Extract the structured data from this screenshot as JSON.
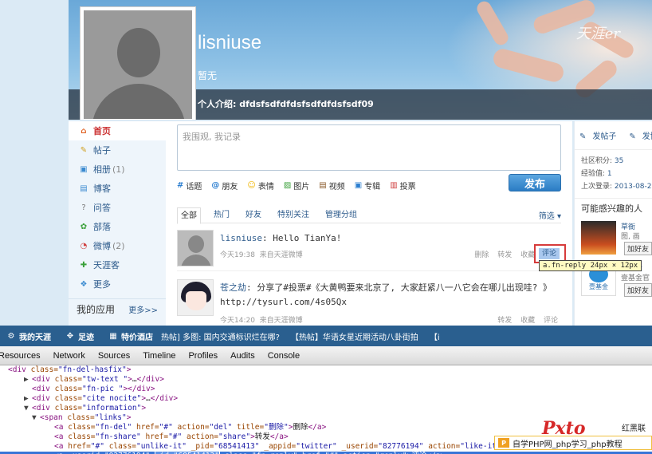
{
  "profile": {
    "name": "lisniuse",
    "status": "暂无",
    "intro": "个人介绍: dfdsfsdfdfdsfsdfdfdsfsdf09",
    "brand": "天涯er"
  },
  "nav": {
    "items": [
      {
        "label": "首页",
        "count": "",
        "icon": "home-icon",
        "active": true
      },
      {
        "label": "帖子",
        "count": "",
        "icon": "post-icon"
      },
      {
        "label": "相册",
        "count": "(1)",
        "icon": "album-icon"
      },
      {
        "label": "博客",
        "count": "",
        "icon": "blog-icon"
      },
      {
        "label": "问答",
        "count": "",
        "icon": "qa-icon"
      },
      {
        "label": "部落",
        "count": "",
        "icon": "tribe-icon"
      },
      {
        "label": "微博",
        "count": "(2)",
        "icon": "weibo-icon"
      },
      {
        "label": "天涯客",
        "count": "",
        "icon": "tianyake-icon"
      },
      {
        "label": "更多",
        "count": "",
        "icon": "more-icon"
      }
    ],
    "apps_label": "我的应用",
    "apps_more": "更多>>"
  },
  "composer": {
    "placeholder": "我围观, 我记录",
    "tools": [
      {
        "label": "话题",
        "icon": "topic-icon",
        "color": "#2d7fd0"
      },
      {
        "label": "朋友",
        "icon": "at-icon",
        "color": "#2d7fd0"
      },
      {
        "label": "表情",
        "icon": "emoji-icon",
        "color": "#f0b400"
      },
      {
        "label": "图片",
        "icon": "picture-icon",
        "color": "#3aa03a"
      },
      {
        "label": "视频",
        "icon": "video-icon",
        "color": "#8a5a2a"
      },
      {
        "label": "专辑",
        "icon": "album-icon",
        "color": "#2d7fd0"
      },
      {
        "label": "投票",
        "icon": "vote-icon",
        "color": "#d04040"
      }
    ],
    "publish_label": "发布"
  },
  "filters": {
    "tabs": [
      "全部",
      "热门",
      "好友",
      "特别关注",
      "管理分组"
    ],
    "sort_label": "筛选"
  },
  "posts": [
    {
      "user": "lisniuse",
      "text": ": Hello TianYa!",
      "time": "今天19:38",
      "source": "来自天涯微博",
      "actions": [
        "删除",
        "转发",
        "收藏",
        "评论"
      ]
    },
    {
      "user": "苍之劫",
      "text": ": 分享了#投票#《大黄鸭要来北京了, 大家赶紧八一八它会在哪儿出现哇? 》http://tysurl.com/4s05Qx",
      "time": "今天14:20",
      "source": "来自天涯微博",
      "actions": [
        "转发",
        "收藏",
        "评论"
      ]
    }
  ],
  "inspector": {
    "tooltip": "a.fn-reply 24px × 12px",
    "reply_label": "评论"
  },
  "right": {
    "links": [
      "发帖子",
      "发博文"
    ],
    "stats": [
      {
        "label": "社区积分:",
        "value": "35"
      },
      {
        "label": "经验值:",
        "value": "1"
      },
      {
        "label": "上次登录:",
        "value": "2013-08-2"
      }
    ],
    "rec_title": "可能感兴趣的人",
    "recs": [
      {
        "name": "草衙",
        "desc": "图, 画",
        "add": "加好友"
      },
      {
        "name": "壹基金",
        "desc": "壹基金官",
        "add": "加好友"
      }
    ]
  },
  "bottombar": {
    "items": [
      {
        "label": "我的天涯",
        "icon": "gear-icon"
      },
      {
        "label": "足迹",
        "icon": "footprint-icon"
      },
      {
        "label": "特价酒店",
        "icon": "hotel-icon"
      }
    ],
    "news": [
      "热帖] 多图: 国内交通标识烂在哪?",
      "【热帖】华语女星近期活动八卦街拍",
      "【i"
    ]
  },
  "devtools": {
    "tabs": [
      "Resources",
      "Network",
      "Sources",
      "Timeline",
      "Profiles",
      "Audits",
      "Console"
    ],
    "lines": [
      {
        "indent": 0,
        "tri": "",
        "html": "<span class='t'>&lt;div</span> <span class='a'>class=</span><span class='s'>\"fn-del-hasfix\"</span><span class='t'>&gt;</span>"
      },
      {
        "indent": 30,
        "tri": "▶",
        "html": "<span class='t'>&lt;div</span> <span class='a'>class=</span><span class='s'>\"tw-text \"</span><span class='t'>&gt;</span><span class='x'>…</span><span class='t'>&lt;/div&gt;</span>"
      },
      {
        "indent": 30,
        "tri": "",
        "html": "<span class='t'>&lt;div</span> <span class='a'>class=</span><span class='s'>\"fn-pic \"</span><span class='t'>&gt;&lt;/div&gt;</span>"
      },
      {
        "indent": 30,
        "tri": "▶",
        "html": "<span class='t'>&lt;div</span> <span class='a'>class=</span><span class='s'>\"cite nocite\"</span><span class='t'>&gt;</span><span class='x'>…</span><span class='t'>&lt;/div&gt;</span>"
      },
      {
        "indent": 30,
        "tri": "▼",
        "html": "<span class='t'>&lt;div</span> <span class='a'>class=</span><span class='s'>\"information\"</span><span class='t'>&gt;</span>"
      },
      {
        "indent": 40,
        "tri": "▼",
        "html": "<span class='t'>&lt;span</span> <span class='a'>class=</span><span class='s'>\"links\"</span><span class='t'>&gt;</span>"
      },
      {
        "indent": 58,
        "tri": "",
        "html": "<span class='t'>&lt;a</span> <span class='a'>class=</span><span class='s'>\"fn-del\"</span> <span class='a'>href=</span><span class='s'>\"#\"</span> <span class='a'>action=</span><span class='s'>\"del\"</span> <span class='a'>title=</span><span class='s'>\"删除\"</span><span class='t'>&gt;</span><span class='x'>删除</span><span class='t'>&lt;/a&gt;</span>"
      },
      {
        "indent": 58,
        "tri": "",
        "html": "<span class='t'>&lt;a</span> <span class='a'>class=</span><span class='s'>\"fn-share\"</span> <span class='a'>href=</span><span class='s'>\"#\"</span> <span class='a'>action=</span><span class='s'>\"share\"</span><span class='t'>&gt;</span><span class='x'>转发</span><span class='t'>&lt;/a&gt;</span>"
      },
      {
        "indent": 58,
        "tri": "",
        "html": "<span class='t'>&lt;a</span> <span class='a'>href=</span><span class='s'>\"#\"</span> <span class='a'>class=</span><span class='s'>\"unlike-it\"</span> <span class='a'>_pid=</span><span class='s'>\"68541413\"</span> <span class='a'>_appid=</span><span class='s'>\"twitter\"</span> <span class='a'>_userid=</span><span class='s'>\"82776194\"</span> <span class='a'>action=</span><span class='s'>\"like-it\"</span> <span class='a'>title=</span><span class='s'>\"…</span>"
      },
      {
        "indent": 58,
        "tri": "",
        "selected": true,
        "html": "<span class='t'>&lt;a</span> <span class='a'>_userid=</span><span class='s'>\"82776194\"</span> <span class='idhl'><span class='a'>_id=</span><span class='s'>\"68541413\"</span></span> <span class='a'>class=</span><span class='s'>\"fn-reply\"</span> <span class='a'>href=</span><span class='s'>\"#\"</span> <span class='a'>action=</span><span class='s'>\"reply\"</span><span class='t'>&gt;</span><span class='x'>评论</span><span class='t'>&lt;/a&gt;</span>"
      }
    ]
  },
  "watermark": {
    "logo": "Pxto",
    "cn": "红黑联盟",
    "bar": "自学PHP网_php学习_php教程"
  }
}
